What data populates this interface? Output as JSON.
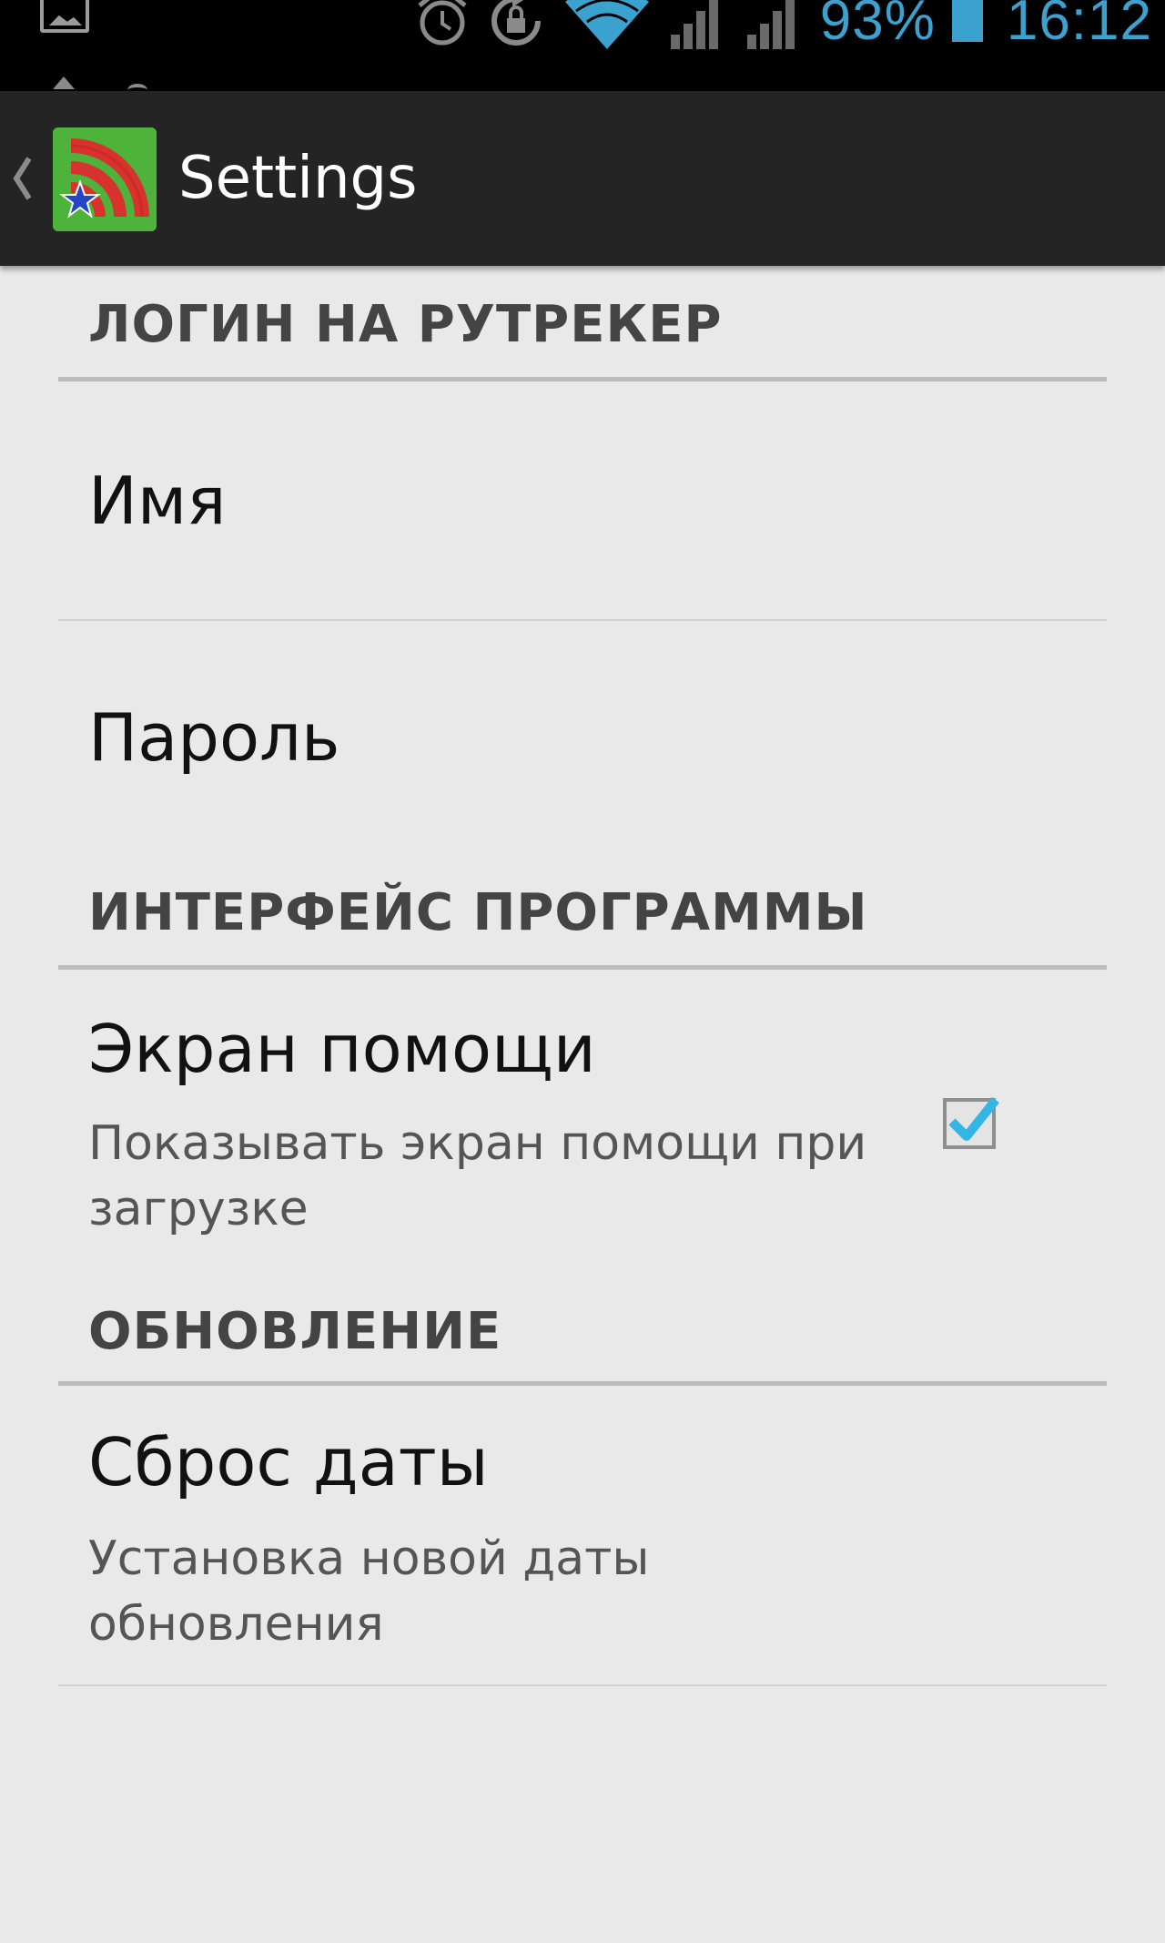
{
  "status_bar": {
    "battery_text": "93%",
    "time": "16:12",
    "accent_color": "#3ba1cf",
    "icons": [
      "gallery-notification-icon",
      "alarm-icon",
      "rotation-lock-icon",
      "wifi-icon",
      "signal-icon",
      "signal-icon",
      "battery-icon"
    ]
  },
  "action_bar": {
    "title": "Settings",
    "icon": "rss-star-app-icon",
    "icon_color": "#4db33a"
  },
  "sections": {
    "login": {
      "header": "ЛОГИН НА РУТРЕКЕР",
      "name_title": "Имя",
      "password_title": "Пароль"
    },
    "interface": {
      "header": "ИНТЕРФЕЙС ПРОГРАММЫ",
      "help_title": "Экран помощи",
      "help_summary": "Показывать экран помощи при загрузке",
      "help_checked": true,
      "checkbox_color": "#33b5e5"
    },
    "update": {
      "header": "ОБНОВЛЕНИЕ",
      "reset_title": "Сброс даты",
      "reset_summary": "Установка новой даты обновления"
    }
  }
}
